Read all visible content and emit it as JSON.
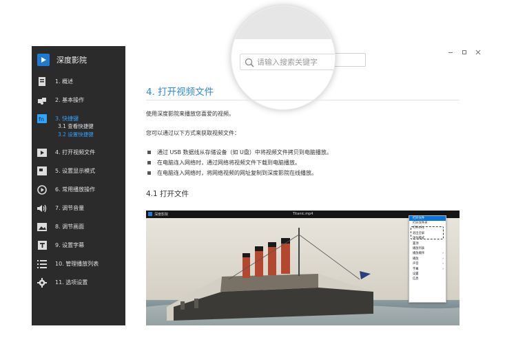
{
  "sidebar": {
    "app_title": "深度影院",
    "items": [
      {
        "label": "1. 概述",
        "icon": "document-icon"
      },
      {
        "label": "2. 基本操作",
        "icon": "puzzle-icon"
      },
      {
        "label": "3. 快捷键",
        "icon": "fn-key-icon",
        "active": true
      },
      {
        "label": "4. 打开视频文件",
        "icon": "video-file-icon"
      },
      {
        "label": "5. 设置显示模式",
        "icon": "display-icon"
      },
      {
        "label": "6. 常用播放操作",
        "icon": "play-icon"
      },
      {
        "label": "7. 调节音量",
        "icon": "volume-icon"
      },
      {
        "label": "8. 调节画面",
        "icon": "picture-icon"
      },
      {
        "label": "9. 设置字幕",
        "icon": "subtitle-icon"
      },
      {
        "label": "10. 管理播放列表",
        "icon": "list-icon"
      },
      {
        "label": "11. 选项设置",
        "icon": "gear-icon"
      }
    ],
    "subitems": [
      {
        "label": "3.1  查看快捷键",
        "active": false
      },
      {
        "label": "3.2  设置快捷键",
        "active": true
      }
    ]
  },
  "search": {
    "placeholder": "请输入搜索关键字"
  },
  "content": {
    "chapter_title": "4. 打开视频文件",
    "intro": "使用深度影院来播放您喜爱的视频。",
    "lead": "您可以通过以下方式来获取视频文件：",
    "bullets": [
      "通过 USB 数据线从存储设备（如 U盘）中将视频文件拷贝到电脑播放。",
      "在电脑连入网络时，通过网络将视频文件下载到电脑播放。",
      "在电脑连入网络时，将网络视频的网址复制到深度影院在线播放。"
    ],
    "section_title": "4.1 打开文件"
  },
  "screenshot": {
    "app_title": "深度影院",
    "file_name": "Titanic.mp4",
    "menu_items": [
      "打开文件",
      "打开文件夹",
      "打开URL",
      "退出全屏",
      "迷你模式",
      "置顶",
      "播放列表",
      "播放顺序",
      "播放",
      "声音",
      "字幕",
      "设置",
      "信息"
    ]
  },
  "colors": {
    "accent": "#2d8ae0",
    "sidebar_bg": "#2b2b2b",
    "active_nav": "#2ea3ff"
  }
}
